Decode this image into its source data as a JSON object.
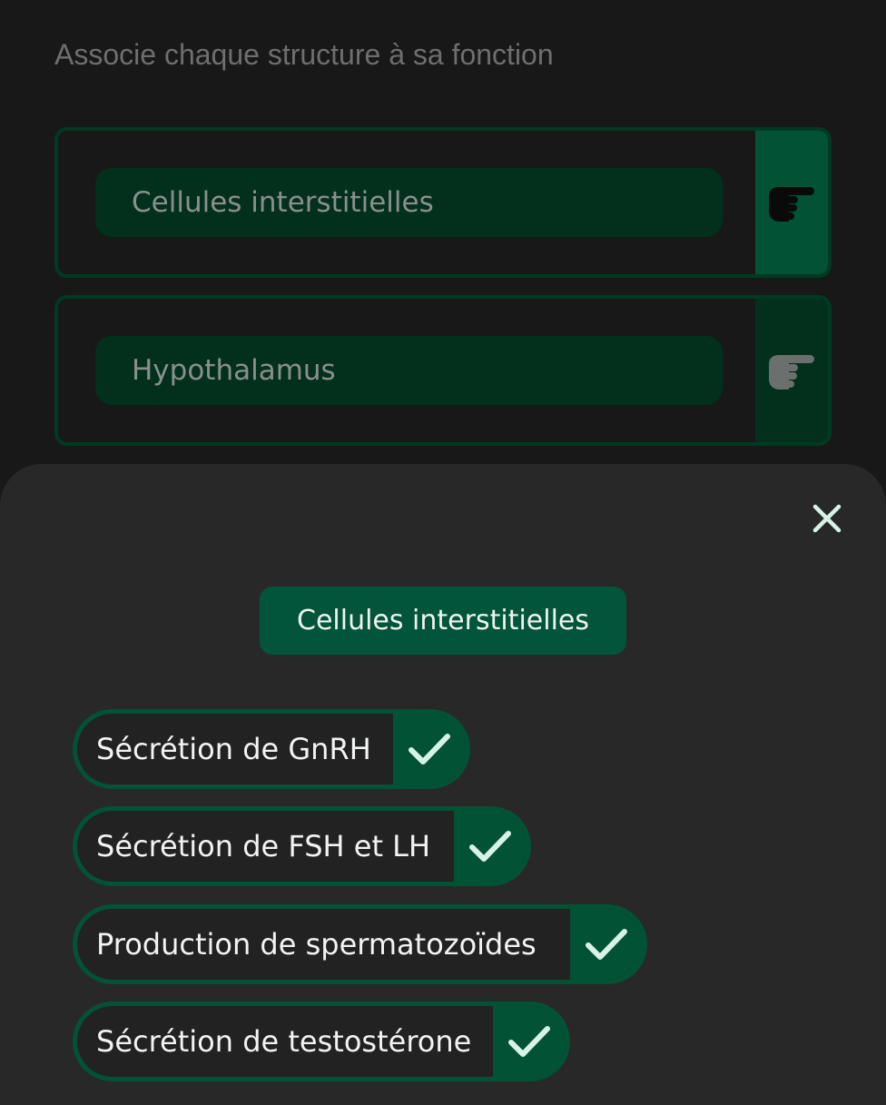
{
  "prompt": "Associe chaque structure à sa fonction",
  "structures": [
    {
      "label": "Cellules interstitielles",
      "icon": "pointing-hand-icon",
      "active": true
    },
    {
      "label": "Hypothalamus",
      "icon": "pointing-hand-icon",
      "active": false
    }
  ],
  "sheet": {
    "close_icon": "close-icon",
    "selected_structure": "Cellules interstitielles",
    "options": [
      {
        "label": "Sécrétion de GnRH",
        "icon": "check-icon"
      },
      {
        "label": "Sécrétion de FSH et LH",
        "icon": "check-icon"
      },
      {
        "label": "Production de spermatozoïdes",
        "icon": "check-icon"
      },
      {
        "label": "Sécrétion de testostérone",
        "icon": "check-icon"
      }
    ]
  },
  "colors": {
    "background": "#181818",
    "sheet": "#282828",
    "accent_green": "#025236",
    "dark_green": "#02301d",
    "check": "#d8f3e6"
  }
}
